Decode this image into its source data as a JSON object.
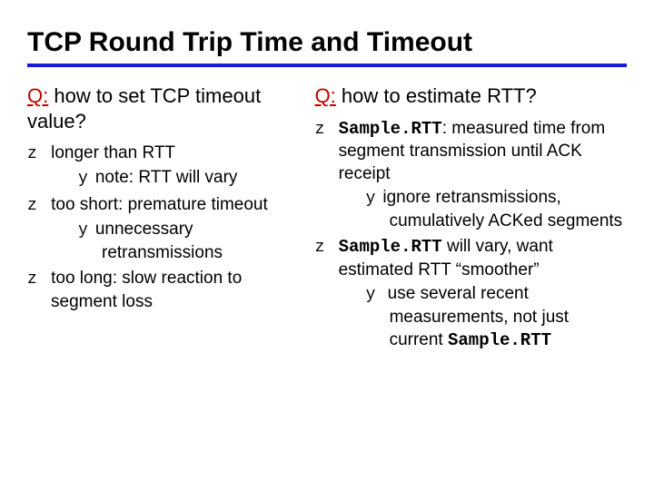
{
  "title": "TCP Round Trip Time and Timeout",
  "left": {
    "q_label": "Q:",
    "q_text": " how to set TCP timeout value?",
    "b1": "longer than RTT",
    "b1s1": "note: RTT will vary",
    "b2": "too short: premature timeout",
    "b2s1": "unnecessary retransmissions",
    "b3": "too long: slow reaction to segment loss"
  },
  "right": {
    "q_label": "Q:",
    "q_text": " how to estimate RTT?",
    "b1_code": "Sample.RTT",
    "b1_rest": ": measured time from segment transmission until ACK receipt",
    "b1s1": "ignore retransmissions, cumulatively ACKed segments",
    "b2_code": "Sample.RTT",
    "b2_rest": " will vary, want estimated RTT “smoother”",
    "b2s1_pre": "use several recent measurements, not just current ",
    "b2s1_code": "Sample.RTT"
  }
}
